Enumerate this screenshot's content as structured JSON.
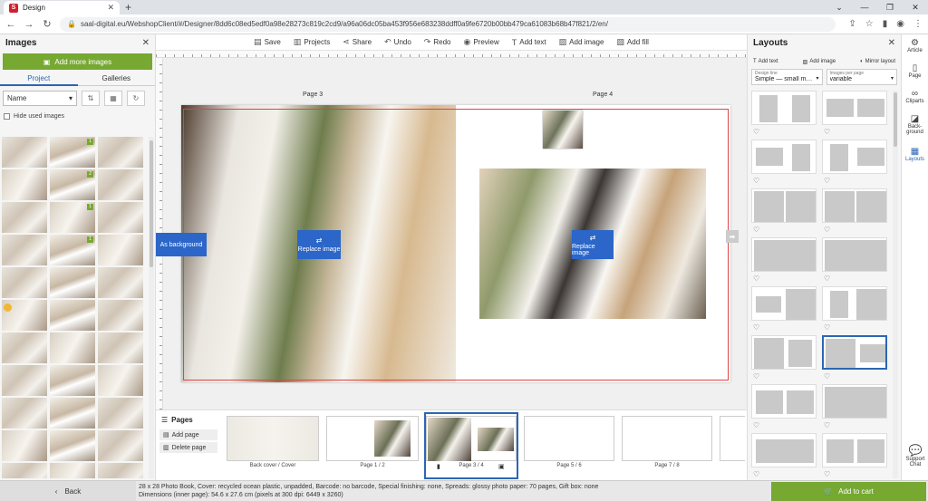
{
  "browser": {
    "tab_title": "Design",
    "favicon": "S",
    "url": "saal-digital.eu/WebshopClient/#/Designer/8dd6c08ed5edf0a98e28273c819c2cd9/a96a06dc05ba453f956e683238ddff0a9fe6720b00bb479ca61083b68b47f821/2/en/"
  },
  "left_panel": {
    "title": "Images",
    "add_button": "Add more images",
    "tabs": [
      "Project",
      "Galleries"
    ],
    "sort_value": "Name",
    "hide_used": "Hide used images",
    "badges": [
      "1",
      "2",
      "1",
      "1"
    ]
  },
  "toolbar": {
    "save": "Save",
    "projects": "Projects",
    "share": "Share",
    "undo": "Undo",
    "redo": "Redo",
    "preview": "Preview",
    "add_text": "Add text",
    "add_image": "Add image",
    "add_fill": "Add fill"
  },
  "canvas": {
    "page_left_label": "Page 3",
    "page_right_label": "Page 4",
    "replace_image": "Replace image",
    "replace_image_2": "Replace image",
    "as_background": "As background"
  },
  "pages_bar": {
    "title": "Pages",
    "add_page": "Add page",
    "delete_page": "Delete page",
    "thumbs": [
      "Back cover / Cover",
      "Page 1 / 2",
      "Page 3 / 4",
      "Page 5 / 6",
      "Page 7 / 8"
    ]
  },
  "right_panel": {
    "title": "Layouts",
    "add_text": "Add text",
    "add_image": "Add image",
    "mirror_layout": "Mirror layout",
    "design_line_label": "Design line",
    "design_line_value": "Simple — small m…",
    "images_per_page_label": "Images per page",
    "images_per_page_value": "variable"
  },
  "icon_strip": {
    "items": [
      "Article",
      "Page",
      "Cliparts",
      "Back-ground",
      "Layouts"
    ],
    "support": "Support Chat"
  },
  "bottom": {
    "back": "Back",
    "info_line1": "28 x 28 Photo Book, Cover: recycled ocean plastic, unpadded, Barcode: no barcode, Special finishing: none, Spreads: glossy photo paper: 70 pages, Gift box: none",
    "info_line2": "Dimensions (inner page): 54.6 x 27.6 cm (pixels at 300 dpi: 6449 x 3260)",
    "add_to_cart": "Add to cart"
  },
  "colors": {
    "accent_green": "#76a832",
    "accent_blue": "#2b66c8",
    "bleed_red": "#d44444"
  }
}
